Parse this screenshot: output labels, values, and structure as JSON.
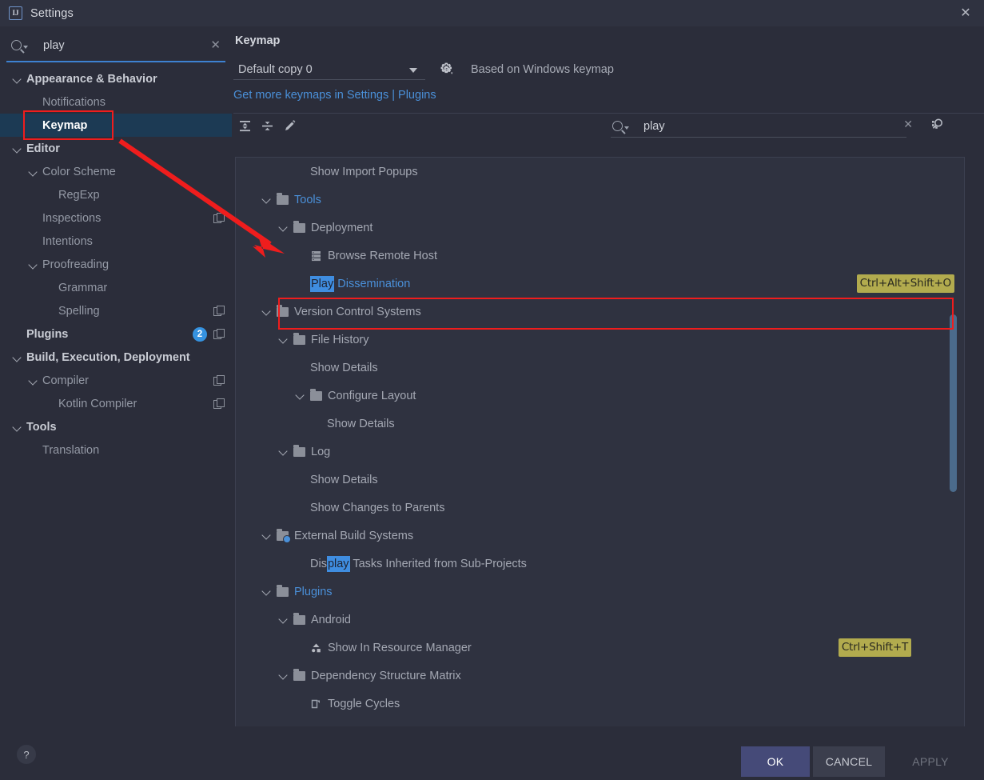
{
  "window": {
    "title": "Settings",
    "app_icon": "intellij-idea-icon",
    "close_icon": "close-icon"
  },
  "sidebar": {
    "search": {
      "value": "play",
      "placeholder": "",
      "icon": "search-icon",
      "clear_icon": "clear-icon"
    },
    "items": [
      {
        "label": "Appearance & Behavior",
        "indent": 0,
        "chevron": true,
        "bold": true,
        "selected": false,
        "badge": null,
        "copy": false
      },
      {
        "label": "Notifications",
        "indent": 1,
        "chevron": false,
        "bold": false,
        "selected": false,
        "badge": null,
        "copy": false
      },
      {
        "label": "Keymap",
        "indent": 1,
        "chevron": false,
        "bold": true,
        "selected": true,
        "badge": null,
        "copy": false
      },
      {
        "label": "Editor",
        "indent": 0,
        "chevron": true,
        "bold": true,
        "selected": false,
        "badge": null,
        "copy": false
      },
      {
        "label": "Color Scheme",
        "indent": 1,
        "chevron": true,
        "bold": false,
        "selected": false,
        "badge": null,
        "copy": false
      },
      {
        "label": "RegExp",
        "indent": 2,
        "chevron": false,
        "bold": false,
        "selected": false,
        "badge": null,
        "copy": false
      },
      {
        "label": "Inspections",
        "indent": 1,
        "chevron": false,
        "bold": false,
        "selected": false,
        "badge": null,
        "copy": true
      },
      {
        "label": "Intentions",
        "indent": 1,
        "chevron": false,
        "bold": false,
        "selected": false,
        "badge": null,
        "copy": false
      },
      {
        "label": "Proofreading",
        "indent": 1,
        "chevron": true,
        "bold": false,
        "selected": false,
        "badge": null,
        "copy": false
      },
      {
        "label": "Grammar",
        "indent": 2,
        "chevron": false,
        "bold": false,
        "selected": false,
        "badge": null,
        "copy": false
      },
      {
        "label": "Spelling",
        "indent": 2,
        "chevron": false,
        "bold": false,
        "selected": false,
        "badge": null,
        "copy": true
      },
      {
        "label": "Plugins",
        "indent": 0,
        "chevron": false,
        "bold": true,
        "selected": false,
        "badge": "2",
        "copy": true
      },
      {
        "label": "Build, Execution, Deployment",
        "indent": 0,
        "chevron": true,
        "bold": true,
        "selected": false,
        "badge": null,
        "copy": false
      },
      {
        "label": "Compiler",
        "indent": 1,
        "chevron": true,
        "bold": false,
        "selected": false,
        "badge": null,
        "copy": true
      },
      {
        "label": "Kotlin Compiler",
        "indent": 2,
        "chevron": false,
        "bold": false,
        "selected": false,
        "badge": null,
        "copy": true
      },
      {
        "label": "Tools",
        "indent": 0,
        "chevron": true,
        "bold": true,
        "selected": false,
        "badge": null,
        "copy": false
      },
      {
        "label": "Translation",
        "indent": 1,
        "chevron": false,
        "bold": false,
        "selected": false,
        "badge": null,
        "copy": false
      }
    ]
  },
  "panel": {
    "title": "Keymap",
    "keymap_selected": "Default copy 0",
    "gear_icon": "gear-icon",
    "based_on": "Based on Windows keymap",
    "plugins_link": "Get more keymaps in Settings | Plugins",
    "toolbar": {
      "expand_all_icon": "expand-all-icon",
      "collapse_all_icon": "collapse-all-icon",
      "edit_icon": "pencil-edit-icon",
      "filter_value": "play",
      "filter_clear_icon": "clear-icon",
      "find_shortcut_icon": "find-by-shortcut-icon"
    }
  },
  "action_tree": [
    {
      "label": "Show Import Popups",
      "indent": 3,
      "chevron": false,
      "icon": null,
      "blue": false,
      "shortcut": null,
      "highlight": null
    },
    {
      "label": "Tools",
      "indent": 1,
      "chevron": true,
      "icon": "folder",
      "blue": true,
      "shortcut": null,
      "highlight": null
    },
    {
      "label": "Deployment",
      "indent": 2,
      "chevron": true,
      "icon": "folder",
      "blue": false,
      "shortcut": null,
      "highlight": null
    },
    {
      "label": "Browse Remote Host",
      "indent": 3,
      "chevron": false,
      "icon": "remote-host",
      "blue": false,
      "shortcut": null,
      "highlight": null
    },
    {
      "label": "Play Dissemination",
      "indent": 3,
      "chevron": false,
      "icon": null,
      "blue": true,
      "shortcut": "Ctrl+Alt+Shift+O",
      "highlight": "Play"
    },
    {
      "label": "Version Control Systems",
      "indent": 1,
      "chevron": true,
      "icon": "folder",
      "blue": false,
      "shortcut": null,
      "highlight": null
    },
    {
      "label": "File History",
      "indent": 2,
      "chevron": true,
      "icon": "folder",
      "blue": false,
      "shortcut": null,
      "highlight": null
    },
    {
      "label": "Show Details",
      "indent": 3,
      "chevron": false,
      "icon": null,
      "blue": false,
      "shortcut": null,
      "highlight": null
    },
    {
      "label": "Configure Layout",
      "indent": 3,
      "chevron": true,
      "icon": "folder",
      "blue": false,
      "shortcut": null,
      "highlight": null
    },
    {
      "label": "Show Details",
      "indent": 4,
      "chevron": false,
      "icon": null,
      "blue": false,
      "shortcut": null,
      "highlight": null
    },
    {
      "label": "Log",
      "indent": 2,
      "chevron": true,
      "icon": "folder",
      "blue": false,
      "shortcut": null,
      "highlight": null
    },
    {
      "label": "Show Details",
      "indent": 3,
      "chevron": false,
      "icon": null,
      "blue": false,
      "shortcut": null,
      "highlight": null
    },
    {
      "label": "Show Changes to Parents",
      "indent": 3,
      "chevron": false,
      "icon": null,
      "blue": false,
      "shortcut": null,
      "highlight": null
    },
    {
      "label": "External Build Systems",
      "indent": 1,
      "chevron": true,
      "icon": "folder-config",
      "blue": false,
      "shortcut": null,
      "highlight": null
    },
    {
      "label": "Display Tasks Inherited from Sub-Projects",
      "indent": 3,
      "chevron": false,
      "icon": null,
      "blue": false,
      "shortcut": null,
      "highlight": "play"
    },
    {
      "label": "Plugins",
      "indent": 1,
      "chevron": true,
      "icon": "folder",
      "blue": true,
      "shortcut": null,
      "highlight": null
    },
    {
      "label": "Android",
      "indent": 2,
      "chevron": true,
      "icon": "folder",
      "blue": false,
      "shortcut": null,
      "highlight": null
    },
    {
      "label": "Show In Resource Manager",
      "indent": 3,
      "chevron": false,
      "icon": "resource-manager",
      "blue": false,
      "shortcut": "Ctrl+Shift+T",
      "highlight": null
    },
    {
      "label": "Dependency Structure Matrix",
      "indent": 2,
      "chevron": true,
      "icon": "folder",
      "blue": false,
      "shortcut": null,
      "highlight": null
    },
    {
      "label": "Toggle Cycles",
      "indent": 3,
      "chevron": false,
      "icon": "toggle-cycles",
      "blue": false,
      "shortcut": null,
      "highlight": null
    }
  ],
  "footer": {
    "help_label": "?",
    "ok_label": "OK",
    "cancel_label": "CANCEL",
    "apply_label": "APPLY"
  },
  "colors": {
    "accent_blue": "#4a90d9",
    "selection_blue": "#1c3a54",
    "highlight_blue": "#3f8de0",
    "shortcut_olive": "#b2ab4e",
    "annotation_red": "#ef1d1d",
    "ok_button": "#454a78"
  }
}
